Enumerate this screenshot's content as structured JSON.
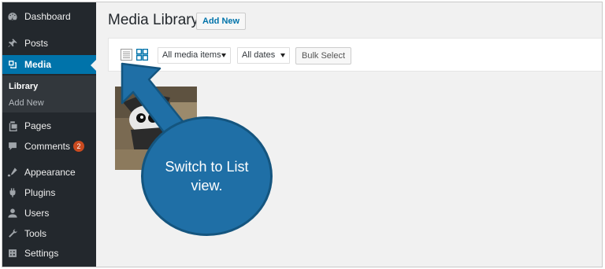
{
  "sidebar": {
    "items": [
      {
        "label": "Dashboard",
        "icon": "dashboard-icon"
      },
      {
        "label": "Posts",
        "icon": "pin-icon"
      },
      {
        "label": "Media",
        "icon": "media-icon"
      },
      {
        "label": "Pages",
        "icon": "pages-icon"
      },
      {
        "label": "Comments",
        "icon": "comments-icon",
        "badge": "2"
      },
      {
        "label": "Appearance",
        "icon": "appearance-icon"
      },
      {
        "label": "Plugins",
        "icon": "plugins-icon"
      },
      {
        "label": "Users",
        "icon": "users-icon"
      },
      {
        "label": "Tools",
        "icon": "tools-icon"
      },
      {
        "label": "Settings",
        "icon": "settings-icon"
      }
    ],
    "submenu": [
      {
        "label": "Library"
      },
      {
        "label": "Add New"
      }
    ]
  },
  "header": {
    "title": "Media Library",
    "add_new": "Add New"
  },
  "toolbar": {
    "filter_type": "All media items",
    "filter_date": "All dates",
    "bulk_select": "Bulk Select"
  },
  "callout": {
    "text": "Switch to List view."
  },
  "colors": {
    "sidebar_bg": "#23282d",
    "active": "#0073aa",
    "callout": "#1f6fa6",
    "badge": "#ca4a1f"
  }
}
